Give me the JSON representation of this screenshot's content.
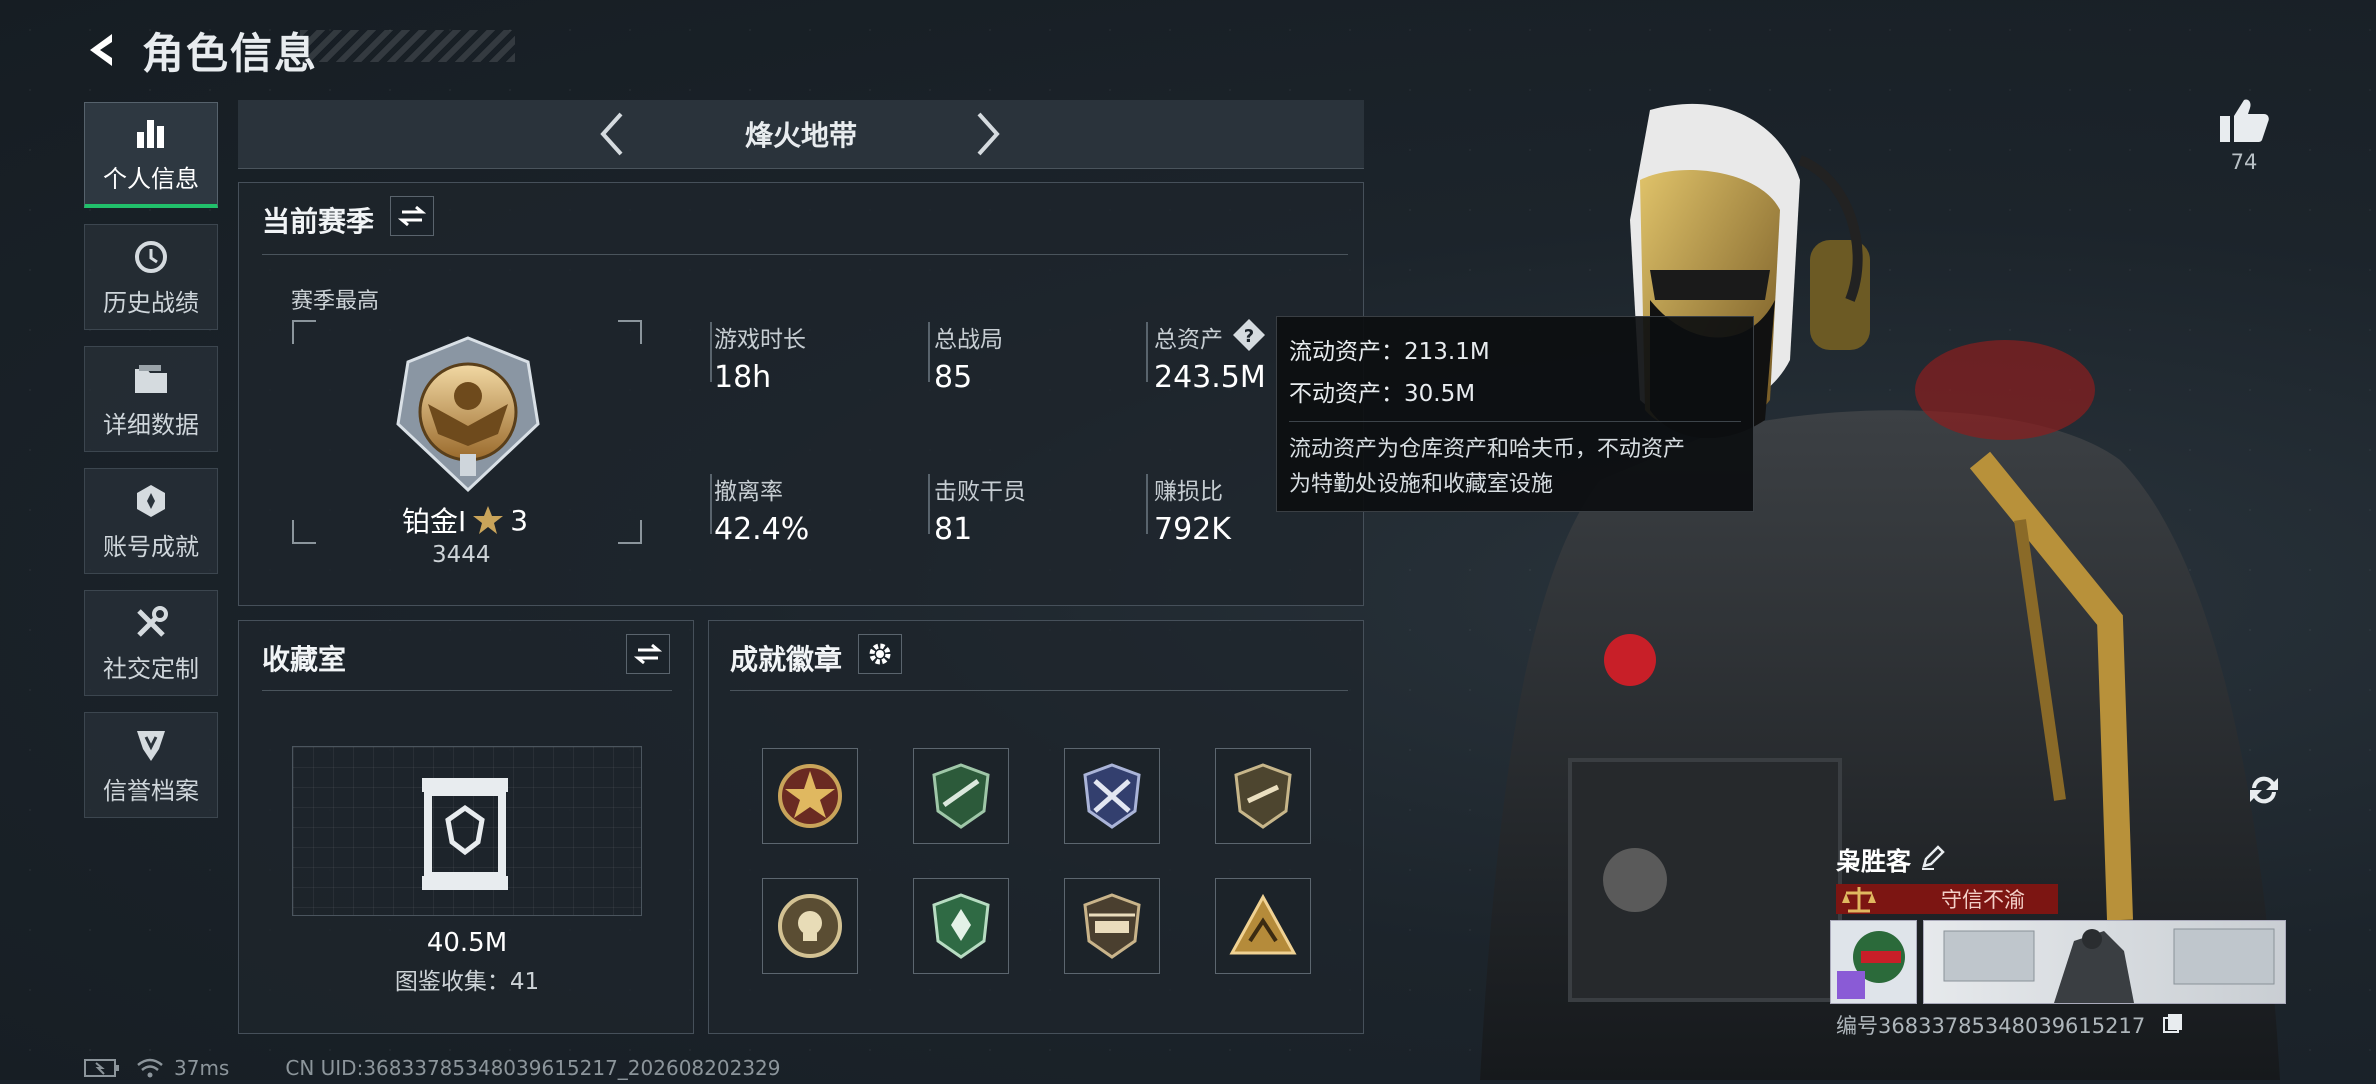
{
  "header": {
    "title": "角色信息"
  },
  "sidebar": {
    "items": [
      {
        "label": "个人信息"
      },
      {
        "label": "历史战绩"
      },
      {
        "label": "详细数据"
      },
      {
        "label": "账号成就"
      },
      {
        "label": "社交定制"
      },
      {
        "label": "信誉档案"
      }
    ]
  },
  "mode": {
    "name": "烽火地带"
  },
  "season": {
    "title": "当前赛季",
    "best_label": "赛季最高",
    "rank_name": "铂金Ⅰ",
    "rank_stars": "3",
    "rank_points": "3444",
    "stats": [
      {
        "label": "游戏时长",
        "value": "18h"
      },
      {
        "label": "总战局",
        "value": "85"
      },
      {
        "label": "总资产",
        "value": "243.5M"
      },
      {
        "label": "撤离率",
        "value": "42.4%"
      },
      {
        "label": "击败干员",
        "value": "81"
      },
      {
        "label": "赚损比",
        "value": "792K"
      }
    ]
  },
  "tooltip": {
    "liquid": "流动资产：213.1M",
    "fixed": "不动资产：30.5M",
    "desc1": "流动资产为仓库资产和哈夫币，不动资产",
    "desc2": "为特勤处设施和收藏室设施"
  },
  "collection": {
    "title": "收藏室",
    "value": "40.5M",
    "count_label": "图鉴收集：41"
  },
  "achievements": {
    "title": "成就徽章"
  },
  "profile": {
    "likes": "74",
    "name": "枭胜客",
    "title_tag": "守信不渝",
    "uid_line": "编号36833785348039615217"
  },
  "footer": {
    "ping": "37ms",
    "uid": "CN UID:36833785348039615217_202608202329"
  },
  "colors": {
    "accent_green": "#21c06b",
    "title_red": "#7c1512",
    "gold": "#c9a45a"
  }
}
